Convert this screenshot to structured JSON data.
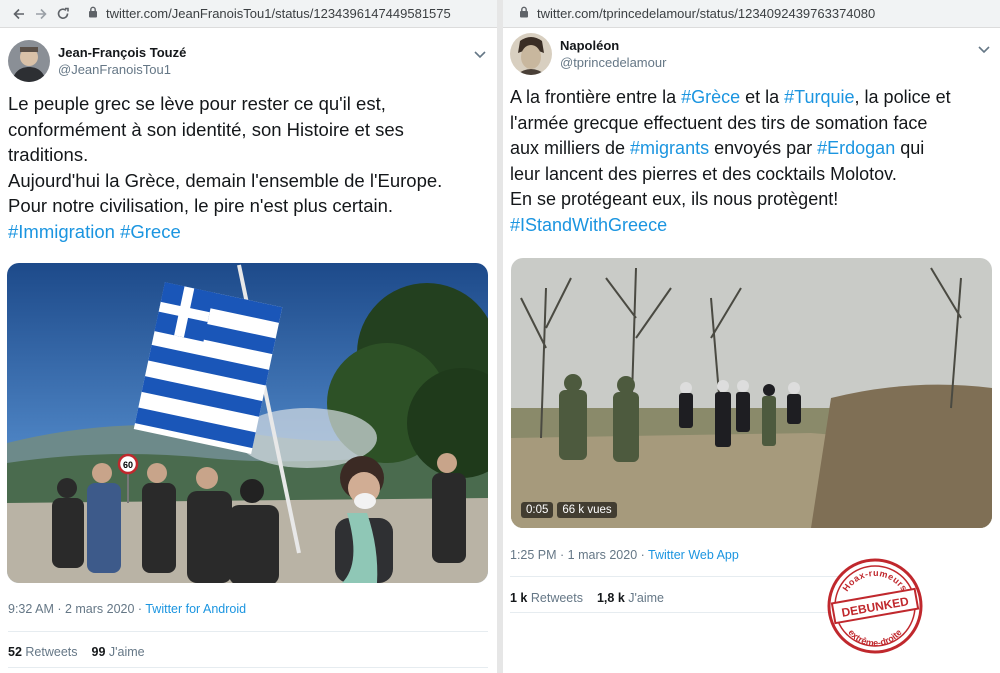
{
  "left": {
    "url": "twitter.com/JeanFranoisTou1/status/1234396147449581575",
    "display_name": "Jean-François Touzé",
    "handle": "@JeanFranoisTou1",
    "text_lines": [
      "Le peuple grec se lève pour rester ce qu'il est,",
      "conformément à son identité, son Histoire et ses",
      "traditions.",
      "Aujourd'hui la Grèce, demain l'ensemble de l'Europe.",
      "Pour notre civilisation, le pire n'est plus certain."
    ],
    "hashtags": [
      "#Immigration",
      "#Grece"
    ],
    "timestamp": "9:32 AM · 2 mars 2020 · ",
    "app": "Twitter for Android",
    "retweets_count": "52",
    "retweets_label": "Retweets",
    "likes_count": "99",
    "likes_label": "J'aime",
    "speed_sign": "60"
  },
  "right": {
    "url": "twitter.com/tprincedelamour/status/1234092439763374080",
    "display_name": "Napoléon",
    "handle": "@tprincedelamour",
    "line1_a": "A la frontière entre la ",
    "line1_tag1": "#Grèce",
    "line1_b": " et la ",
    "line1_tag2": "#Turquie",
    "line1_c": ", la police et",
    "line2": "l'armée grecque effectuent des tirs de somation face",
    "line3_a": "aux milliers de ",
    "line3_tag": "#migrants",
    "line3_b": " envoyés par ",
    "line3_tag2": "#Erdogan",
    "line3_c": " qui",
    "line4": "leur lancent des pierres et des cocktails Molotov.",
    "line5": "En se protégeant eux, ils nous protègent!",
    "line6_tag": "#IStandWithGreece",
    "video_time": "0:05",
    "video_views": "66 k vues",
    "timestamp": "1:25 PM · 1 mars 2020 · ",
    "app": "Twitter Web App",
    "retweets_count": "1 k",
    "retweets_label": "Retweets",
    "likes_count": "1,8 k",
    "likes_label": "J'aime"
  },
  "stamp": {
    "top_text": "Hoax-rumeurs",
    "center_text": "DEBUNKED",
    "bottom_text": "extrême-droite",
    "color": "#c0282d"
  },
  "colors": {
    "link": "#1b95e0",
    "text": "#14171a",
    "muted": "#657786"
  }
}
